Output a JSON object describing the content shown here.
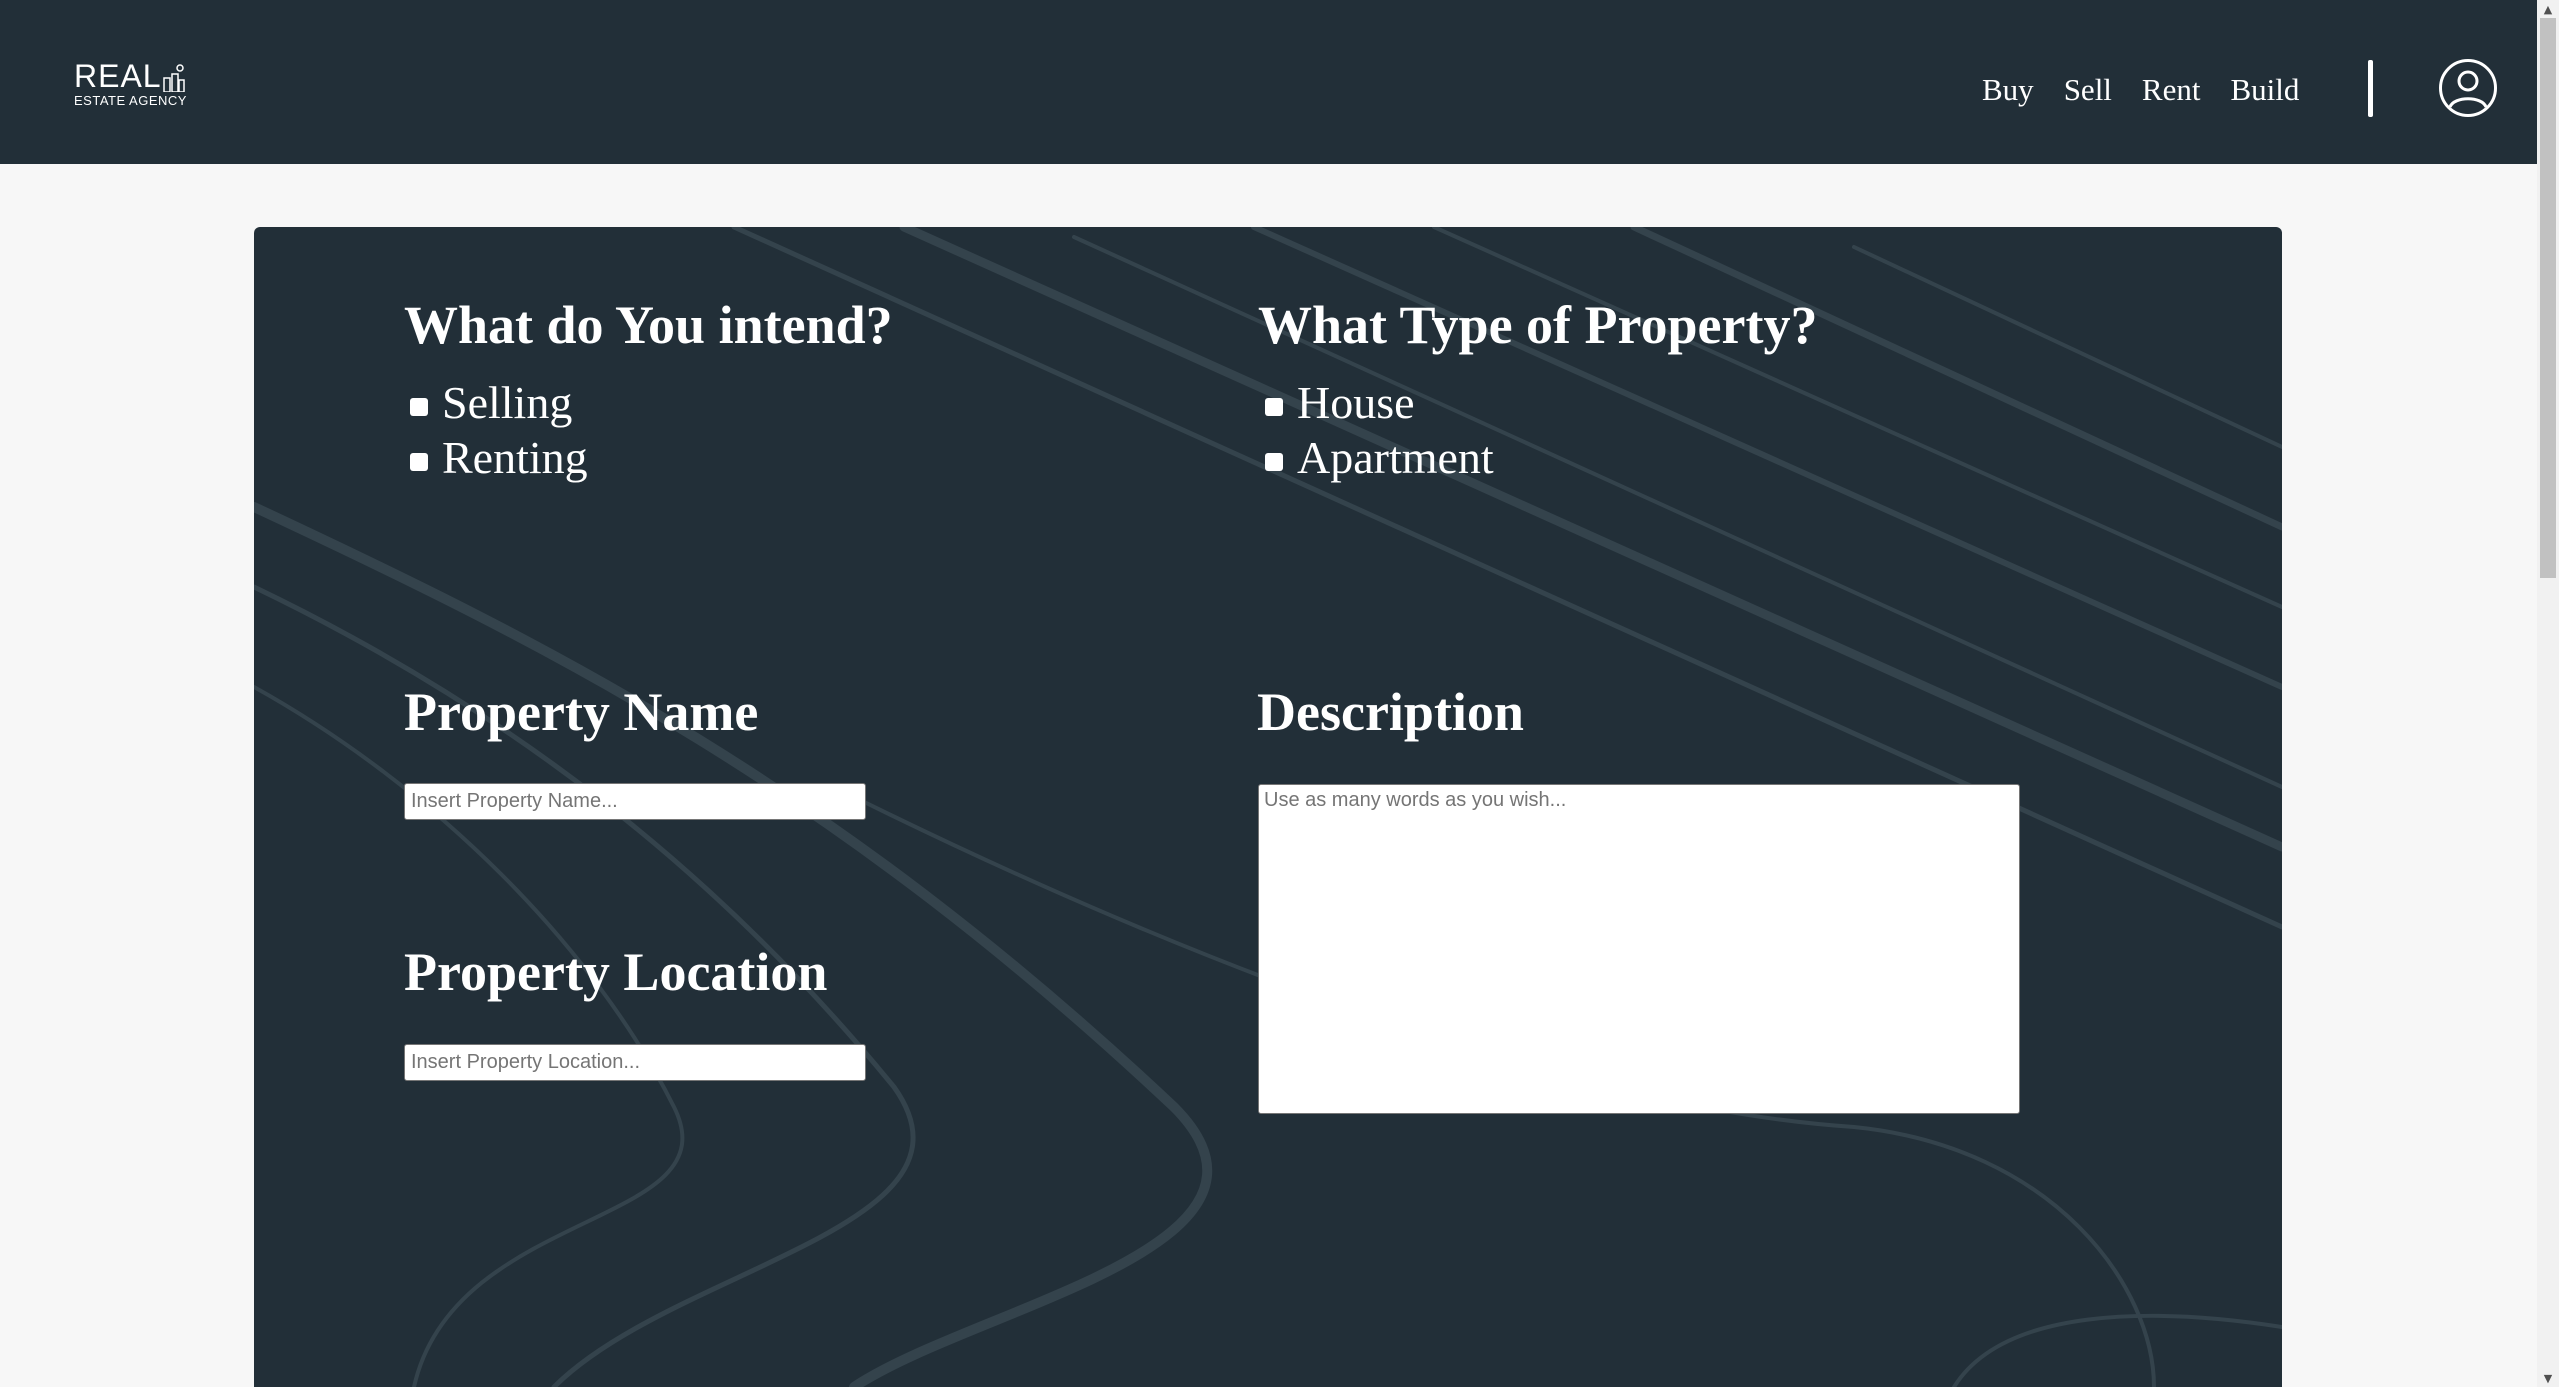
{
  "header": {
    "logo": {
      "line1": "REAL",
      "line2": "ESTATE AGENCY"
    },
    "nav": [
      "Buy",
      "Sell",
      "Rent",
      "Build"
    ],
    "user_icon": "user-circle-icon"
  },
  "form": {
    "intent": {
      "title": "What do You intend?",
      "options": [
        "Selling",
        "Renting"
      ]
    },
    "property_type": {
      "title": "What Type of Property?",
      "options": [
        "House",
        "Apartment"
      ]
    },
    "name": {
      "title": "Property Name",
      "placeholder": "Insert Property Name..."
    },
    "location": {
      "title": "Property Location",
      "placeholder": "Insert Property Location..."
    },
    "description": {
      "title": "Description",
      "placeholder": "Use as many words as you wish..."
    }
  },
  "colors": {
    "header_bg": "#222f38",
    "panel_bg": "#222f38",
    "page_bg": "#f7f7f7",
    "text": "#ffffff"
  }
}
